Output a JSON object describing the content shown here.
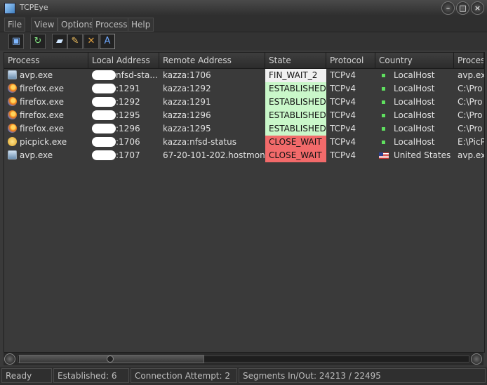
{
  "window": {
    "title": "TCPEye"
  },
  "menu": [
    "File",
    "View",
    "Options",
    "Process",
    "Help"
  ],
  "toolbar": [
    "save-icon",
    "refresh-icon",
    "message-icon",
    "clean-icon",
    "kill-icon",
    "font-icon"
  ],
  "columns": [
    "Process",
    "Local Address",
    "Remote Address",
    "State",
    "Protocol",
    "Country",
    "Process"
  ],
  "rows": [
    {
      "icon": "avp",
      "process": "avp.exe",
      "local": "nfsd-sta...",
      "remote": "kazza:1706",
      "state": "FIN_WAIT_2",
      "stateClass": "st-fin",
      "protocol": "TCPv4",
      "country": "LocalHost",
      "flag": "local",
      "path": "avp.exe"
    },
    {
      "icon": "ff",
      "process": "firefox.exe",
      "local": ":1291",
      "remote": "kazza:1292",
      "state": "ESTABLISHED",
      "stateClass": "st-est",
      "protocol": "TCPv4",
      "country": "LocalHost",
      "flag": "local",
      "path": "C:\\Pro"
    },
    {
      "icon": "ff",
      "process": "firefox.exe",
      "local": ":1292",
      "remote": "kazza:1291",
      "state": "ESTABLISHED",
      "stateClass": "st-est",
      "protocol": "TCPv4",
      "country": "LocalHost",
      "flag": "local",
      "path": "C:\\Pro"
    },
    {
      "icon": "ff",
      "process": "firefox.exe",
      "local": ":1295",
      "remote": "kazza:1296",
      "state": "ESTABLISHED",
      "stateClass": "st-est",
      "protocol": "TCPv4",
      "country": "LocalHost",
      "flag": "local",
      "path": "C:\\Pro"
    },
    {
      "icon": "ff",
      "process": "firefox.exe",
      "local": ":1296",
      "remote": "kazza:1295",
      "state": "ESTABLISHED",
      "stateClass": "st-est",
      "protocol": "TCPv4",
      "country": "LocalHost",
      "flag": "local",
      "path": "C:\\Pro"
    },
    {
      "icon": "pp",
      "process": "picpick.exe",
      "local": ":1706",
      "remote": "kazza:nfsd-status",
      "state": "CLOSE_WAIT",
      "stateClass": "st-close",
      "protocol": "TCPv4",
      "country": "LocalHost",
      "flag": "local",
      "path": "E:\\PicP"
    },
    {
      "icon": "avp",
      "process": "avp.exe",
      "local": ":1707",
      "remote": "67-20-101-202.hostmon...",
      "state": "CLOSE_WAIT",
      "stateClass": "st-close",
      "protocol": "TCPv4",
      "country": "United States",
      "flag": "us",
      "path": "avp.ex"
    }
  ],
  "status": {
    "ready": "Ready",
    "established": "Established: 6",
    "attempt": "Connection Attempt: 2",
    "segments": "Segments In/Out: 24213 / 22495"
  },
  "colors": {
    "fin": "#f0f0f0",
    "established": "#c9f7c9",
    "close_wait": "#f26a6a"
  }
}
